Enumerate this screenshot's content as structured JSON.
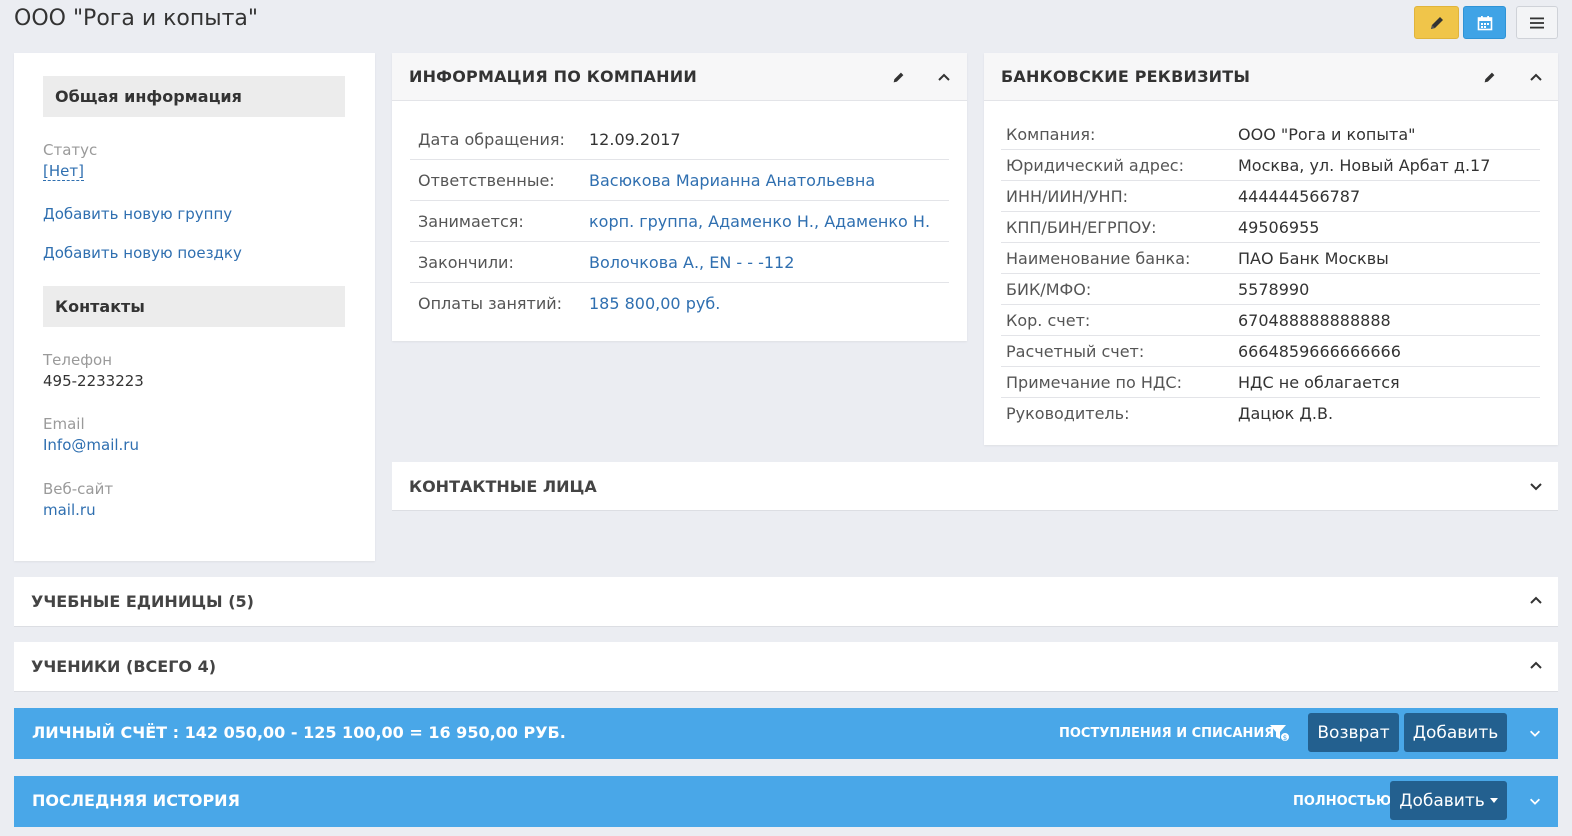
{
  "page": {
    "title": "ООО \"Рога и копыта\""
  },
  "toolbar": {
    "edit_icon": "pencil-icon",
    "calendar_icon": "calendar-icon",
    "menu_icon": "hamburger-icon"
  },
  "general": {
    "heading": "Общая информация",
    "status_label": "Статус",
    "status_value": "[Нет]",
    "add_group": "Добавить новую группу",
    "add_trip": "Добавить новую поездку"
  },
  "contacts": {
    "heading": "Контакты",
    "phone_label": "Телефон",
    "phone_value": "495-2233223",
    "email_label": "Email",
    "email_value": "Info@mail.ru",
    "website_label": "Веб-сайт",
    "website_value": "mail.ru"
  },
  "company_info": {
    "title": "ИНФОРМАЦИЯ ПО КОМПАНИИ",
    "rows": [
      {
        "label": "Дата обращения:",
        "value": "12.09.2017"
      },
      {
        "label": "Ответственные:",
        "value": "Васюкова Марианна Анатольевна"
      },
      {
        "label": "Занимается:",
        "value": "корп. группа, Адаменко Н., Адаменко Н."
      },
      {
        "label": "Закончили:",
        "value": "Волочкова А., EN - - -112"
      },
      {
        "label": "Оплаты занятий:",
        "value": "185 800,00 руб."
      }
    ]
  },
  "bank": {
    "title": "БАНКОВСКИЕ РЕКВИЗИТЫ",
    "rows": [
      {
        "label": "Компания:",
        "value": "ООО \"Рога и копыта\""
      },
      {
        "label": "Юридический адрес:",
        "value": "Москва, ул. Новый Арбат д.17"
      },
      {
        "label": "ИНН/ИИН/УНП:",
        "value": "444444566787"
      },
      {
        "label": "КПП/БИН/ЕГРПОУ:",
        "value": "49506955"
      },
      {
        "label": "Наименование банка:",
        "value": "ПАО Банк Москвы"
      },
      {
        "label": "БИК/МФО:",
        "value": "5578990"
      },
      {
        "label": "Кор. счет:",
        "value": "670488888888888"
      },
      {
        "label": "Расчетный счет:",
        "value": "6664859666666666"
      },
      {
        "label": "Примечание по НДС:",
        "value": "НДС не облагается"
      },
      {
        "label": "Руководитель:",
        "value": "Дацюк Д.В."
      }
    ]
  },
  "panels": {
    "contact_persons": "КОНТАКТНЫЕ ЛИЦА",
    "units": "УЧЕБНЫЕ ЕДИНИЦЫ (5)",
    "students": "УЧЕНИКИ (ВСЕГО 4)"
  },
  "account": {
    "title": "ЛИЧНЫЙ СЧЁТ :  142 050,00 - 125 100,00 = 16 950,00 РУБ.",
    "filter_label": "ПОСТУПЛЕНИЯ И СПИСАНИЯ",
    "refund_button": "Возврат",
    "add_button": "Добавить"
  },
  "history": {
    "title": "ПОСЛЕДНЯЯ ИСТОРИЯ",
    "full_label": "ПОЛНОСТЬЮ",
    "add_button": "Добавить"
  }
}
